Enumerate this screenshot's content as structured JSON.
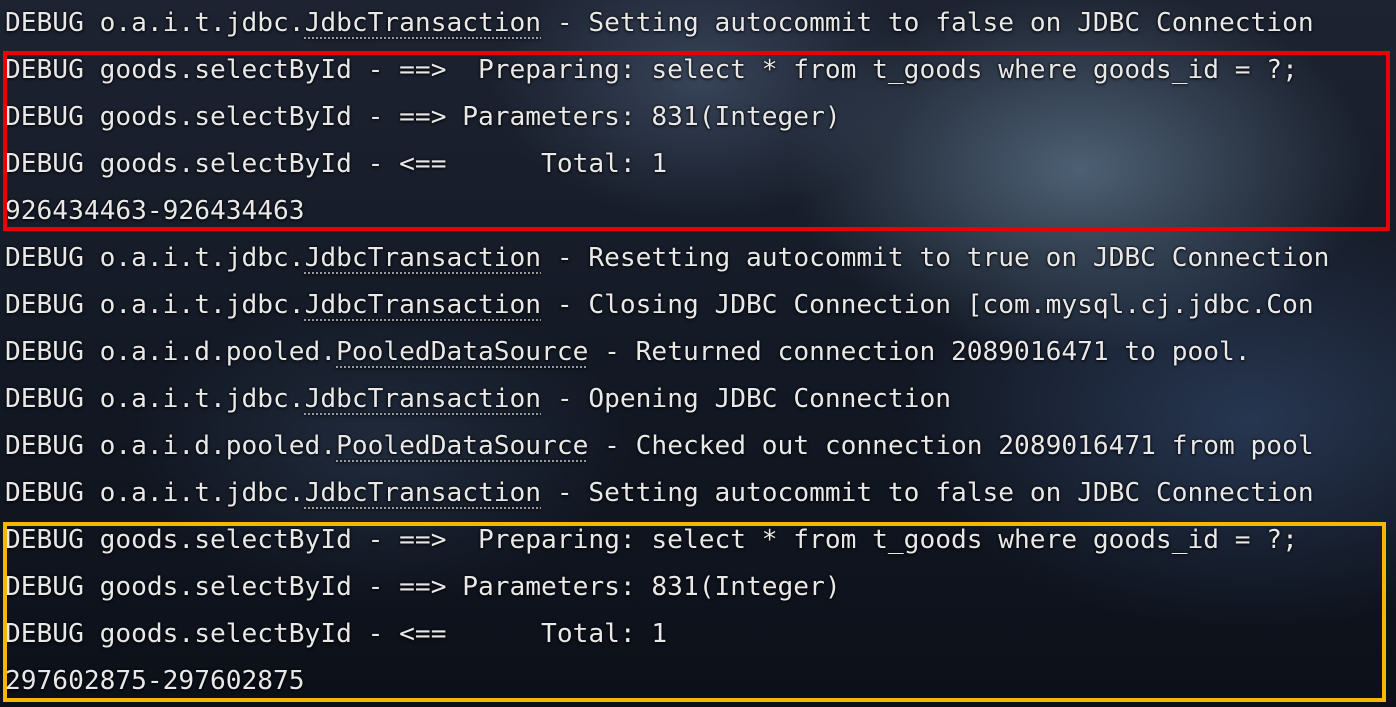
{
  "console": {
    "lines": [
      {
        "prefix": "DEBUG o.a.i.t.jdbc.",
        "logger": "JdbcTransaction",
        "rest": " - Setting autocommit to false on JDBC Connection"
      },
      {
        "prefix": "",
        "logger": "",
        "rest": "DEBUG goods.selectById - ==>  Preparing: select * from t_goods where goods_id = ?;"
      },
      {
        "prefix": "",
        "logger": "",
        "rest": "DEBUG goods.selectById - ==> Parameters: 831(Integer)"
      },
      {
        "prefix": "",
        "logger": "",
        "rest": "DEBUG goods.selectById - <==      Total: 1"
      },
      {
        "prefix": "",
        "logger": "",
        "rest": "926434463-926434463"
      },
      {
        "prefix": "DEBUG o.a.i.t.jdbc.",
        "logger": "JdbcTransaction",
        "rest": " - Resetting autocommit to true on JDBC Connection"
      },
      {
        "prefix": "DEBUG o.a.i.t.jdbc.",
        "logger": "JdbcTransaction",
        "rest": " - Closing JDBC Connection [com.mysql.cj.jdbc.Con"
      },
      {
        "prefix": "DEBUG o.a.i.d.pooled.",
        "logger": "PooledDataSource",
        "rest": " - Returned connection 2089016471 to pool."
      },
      {
        "prefix": "DEBUG o.a.i.t.jdbc.",
        "logger": "JdbcTransaction",
        "rest": " - Opening JDBC Connection"
      },
      {
        "prefix": "DEBUG o.a.i.d.pooled.",
        "logger": "PooledDataSource",
        "rest": " - Checked out connection 2089016471 from pool"
      },
      {
        "prefix": "DEBUG o.a.i.t.jdbc.",
        "logger": "JdbcTransaction",
        "rest": " - Setting autocommit to false on JDBC Connection"
      },
      {
        "prefix": "",
        "logger": "",
        "rest": "DEBUG goods.selectById - ==>  Preparing: select * from t_goods where goods_id = ?;"
      },
      {
        "prefix": "",
        "logger": "",
        "rest": "DEBUG goods.selectById - ==> Parameters: 831(Integer)"
      },
      {
        "prefix": "",
        "logger": "",
        "rest": "DEBUG goods.selectById - <==      Total: 1"
      },
      {
        "prefix": "",
        "logger": "",
        "rest": "297602875-297602875"
      }
    ]
  },
  "highlights": {
    "first_query_color": "#e8000b",
    "second_query_color": "#f5b800"
  }
}
